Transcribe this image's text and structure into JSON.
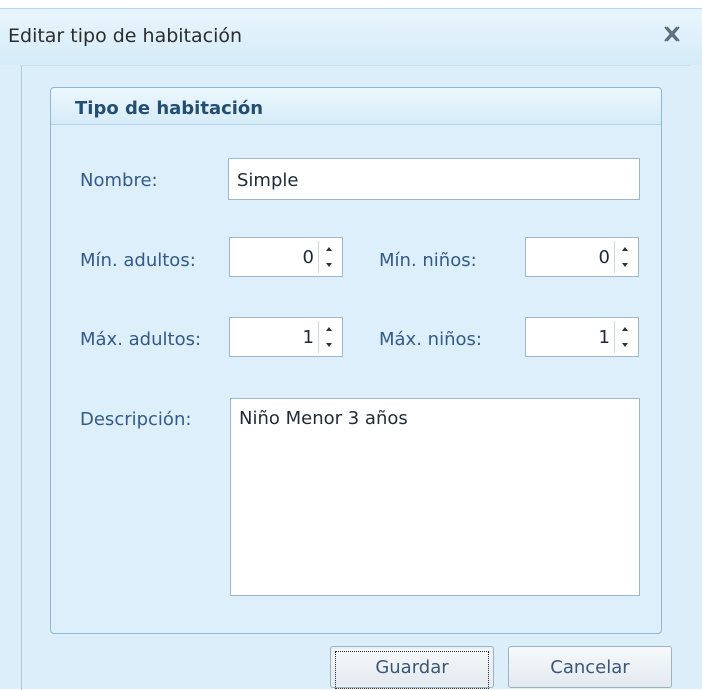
{
  "window": {
    "title": "Editar tipo de habitación"
  },
  "group": {
    "title": "Tipo de habitación"
  },
  "form": {
    "nombre_label": "Nombre:",
    "nombre_value": "Simple",
    "min_adultos_label": "Mín. adultos:",
    "min_adultos_value": "0",
    "min_ninos_label": "Mín. niños:",
    "min_ninos_value": "0",
    "max_adultos_label": "Máx. adultos:",
    "max_adultos_value": "1",
    "max_ninos_label": "Máx. niños:",
    "max_ninos_value": "1",
    "descripcion_label": "Descripción:",
    "descripcion_value": "Niño Menor 3 años"
  },
  "buttons": {
    "guardar": "Guardar",
    "cancelar": "Cancelar"
  },
  "icons": {
    "close": "close-icon",
    "spin_up": "chevron-up-icon",
    "spin_down": "chevron-down-icon"
  }
}
